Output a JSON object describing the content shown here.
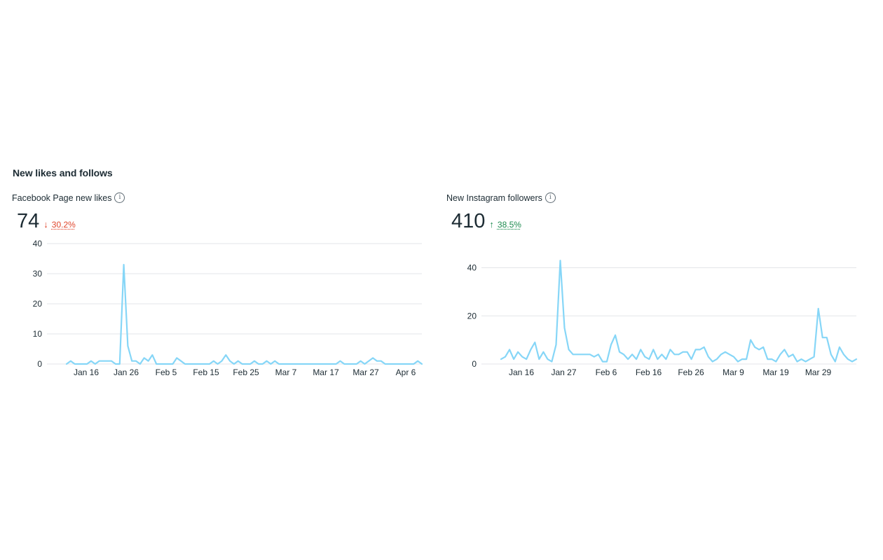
{
  "section": {
    "title": "New likes and follows"
  },
  "cards": [
    {
      "label": "Facebook Page new likes",
      "info_icon": "info-icon",
      "value": "74",
      "delta": "30.2%",
      "delta_direction": "down",
      "delta_color": "#e0452b"
    },
    {
      "label": "New Instagram followers",
      "info_icon": "info-icon",
      "value": "410",
      "delta": "38.5%",
      "delta_direction": "up",
      "delta_color": "#1b8a4e"
    }
  ],
  "chart_data": [
    {
      "type": "line",
      "title": "Facebook Page new likes",
      "color": "#86d6f7",
      "grid": true,
      "ylim": [
        0,
        40
      ],
      "yticks": [
        0,
        10,
        20,
        30,
        40
      ],
      "x_start": "Jan 10",
      "xticks": [
        "Jan 16",
        "Jan 26",
        "Feb 5",
        "Feb 15",
        "Feb 25",
        "Mar 7",
        "Mar 17",
        "Mar 27",
        "Apr 6"
      ],
      "values": [
        0,
        1,
        0,
        0,
        0,
        0,
        1,
        0,
        1,
        1,
        1,
        1,
        0,
        0,
        33,
        6,
        1,
        1,
        0,
        2,
        1,
        3,
        0,
        0,
        0,
        0,
        0,
        2,
        1,
        0,
        0,
        0,
        0,
        0,
        0,
        0,
        1,
        0,
        1,
        3,
        1,
        0,
        1,
        0,
        0,
        0,
        1,
        0,
        0,
        1,
        0,
        1,
        0,
        0,
        0,
        0,
        0,
        0,
        0,
        0,
        0,
        0,
        0,
        0,
        0,
        0,
        0,
        1,
        0,
        0,
        0,
        0,
        1,
        0,
        1,
        2,
        1,
        1,
        0,
        0,
        0,
        0,
        0,
        0,
        0,
        0,
        1,
        0
      ]
    },
    {
      "type": "line",
      "title": "New Instagram followers",
      "color": "#86d6f7",
      "grid": true,
      "ylim": [
        0,
        48
      ],
      "yticks": [
        0,
        20,
        40
      ],
      "x_start": "Jan 10",
      "xticks": [
        "Jan 16",
        "Jan 27",
        "Feb 6",
        "Feb 16",
        "Feb 26",
        "Mar 9",
        "Mar 19",
        "Mar 29"
      ],
      "values": [
        2,
        3,
        6,
        2,
        5,
        3,
        2,
        6,
        9,
        2,
        5,
        2,
        1,
        8,
        43,
        15,
        6,
        4,
        4,
        4,
        4,
        4,
        3,
        4,
        1,
        1,
        8,
        12,
        5,
        4,
        2,
        4,
        2,
        6,
        3,
        2,
        6,
        2,
        4,
        2,
        6,
        4,
        4,
        5,
        5,
        2,
        6,
        6,
        7,
        3,
        1,
        2,
        4,
        5,
        4,
        3,
        1,
        2,
        2,
        10,
        7,
        6,
        7,
        2,
        2,
        1,
        4,
        6,
        3,
        4,
        1,
        2,
        1,
        2,
        3,
        23,
        11,
        11,
        4,
        1,
        7,
        4,
        2,
        1,
        2
      ]
    }
  ]
}
